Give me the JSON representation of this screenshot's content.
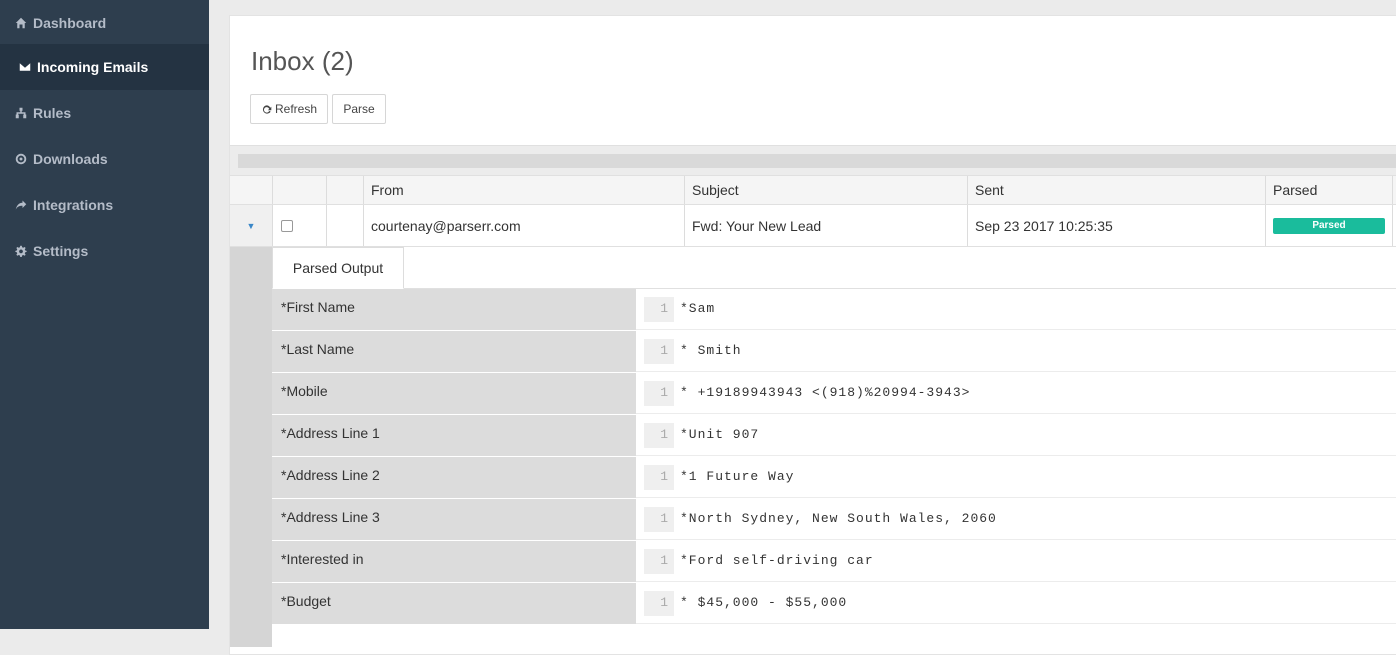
{
  "sidebar": {
    "items": [
      {
        "label": "Dashboard",
        "icon": "home-icon"
      },
      {
        "label": "Incoming Emails",
        "icon": "envelope-icon"
      },
      {
        "label": "Rules",
        "icon": "sitemap-icon"
      },
      {
        "label": "Downloads",
        "icon": "download-circle-icon"
      },
      {
        "label": "Integrations",
        "icon": "share-arrow-icon"
      },
      {
        "label": "Settings",
        "icon": "gear-icon"
      }
    ],
    "active_index": 1
  },
  "main": {
    "title": "Inbox (2)",
    "toolbar": {
      "refresh_label": "Refresh",
      "parse_label": "Parse"
    },
    "columns": [
      "From",
      "Subject",
      "Sent",
      "Parsed"
    ],
    "row": {
      "from": "courtenay@parserr.com",
      "subject": "Fwd: Your New Lead",
      "sent": "Sep 23 2017 10:25:35",
      "parsed_badge": "Parsed"
    },
    "detail_tab": "Parsed Output",
    "fields": [
      {
        "label": "*First Name",
        "line": "1",
        "value": "*Sam"
      },
      {
        "label": "*Last Name",
        "line": "1",
        "value": "* Smith"
      },
      {
        "label": "*Mobile",
        "line": "1",
        "value": "* +19189943943 <(918)%20994-3943>"
      },
      {
        "label": "*Address Line 1",
        "line": "1",
        "value": "*Unit 907"
      },
      {
        "label": "*Address Line 2",
        "line": "1",
        "value": "*1 Future Way"
      },
      {
        "label": "*Address Line 3",
        "line": "1",
        "value": "*North Sydney, New South Wales, 2060"
      },
      {
        "label": "*Interested in",
        "line": "1",
        "value": "*Ford self-driving car"
      },
      {
        "label": "*Budget",
        "line": "1",
        "value": "* $45,000 - $55,000"
      }
    ]
  },
  "colors": {
    "sidebar_bg": "#2e3e4e",
    "active_bg": "#243342",
    "badge": "#1abc9c"
  }
}
